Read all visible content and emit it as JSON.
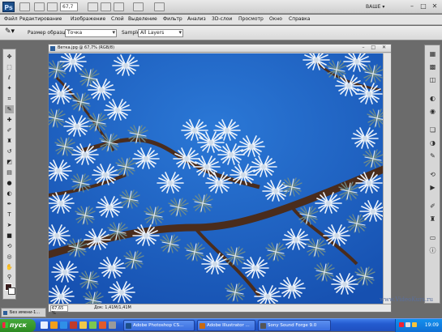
{
  "app": {
    "logo_text": "Ps",
    "zoom_value": "67,7",
    "workspace_label": "ВАШЕ ▾",
    "window_buttons": [
      "–",
      "□",
      "✕"
    ]
  },
  "menu": {
    "items": [
      "Файл",
      "Редактирование",
      "Изображение",
      "Слой",
      "Выделение",
      "Фильтр",
      "Анализ",
      "3D-слои",
      "Просмотр",
      "Окно",
      "Справка"
    ]
  },
  "options": {
    "size_label": "Размер образца:",
    "size_value": "Точка",
    "sample_label": "Sample:",
    "sample_value": "All Layers"
  },
  "document": {
    "title": "Ветка.jpg @ 67,7% (RGB/8)",
    "title_buttons": "– □ ✕",
    "status_zoom": "67,65 %",
    "status_doc": "Док: 1,41М/1,41М"
  },
  "minimized_doc": "Без имени-1...",
  "watermark": "www.VideoKurs.ru",
  "taskbar": {
    "start_label": "пуск",
    "tasks": [
      {
        "label": "Adobe Photoshop CS...",
        "color": "#1d4f8a"
      },
      {
        "label": "Adobe Illustrator ...",
        "color": "#c96a12"
      },
      {
        "label": "Sony Sound Forge 9.0",
        "color": "#555555"
      }
    ],
    "clock": "19:09"
  },
  "colors": {
    "sky": "#1f66c6",
    "foreground_swatch": "#3a1e1e",
    "background_swatch": "#ffffff",
    "taskbar": "#245bd0",
    "start_button": "#2d8a22"
  },
  "icons": {
    "tools": [
      "move-icon",
      "marquee-icon",
      "lasso-icon",
      "quick-select-icon",
      "crop-icon",
      "eyedropper-icon",
      "healing-icon",
      "brush-icon",
      "stamp-icon",
      "history-brush-icon",
      "eraser-icon",
      "gradient-icon",
      "blur-icon",
      "dodge-icon",
      "pen-icon",
      "type-icon",
      "path-select-icon",
      "shape-icon",
      "3d-rotate-icon",
      "3d-camera-icon",
      "hand-icon",
      "zoom-icon"
    ],
    "panels": [
      "color-panel-icon",
      "swatches-panel-icon",
      "styles-panel-icon",
      "adjustments-panel-icon",
      "masks-panel-icon",
      "layers-panel-icon",
      "channels-panel-icon",
      "paths-panel-icon",
      "history-panel-icon",
      "actions-panel-icon",
      "brushes-panel-icon",
      "clone-source-panel-icon",
      "navigator-panel-icon",
      "info-panel-icon"
    ]
  }
}
